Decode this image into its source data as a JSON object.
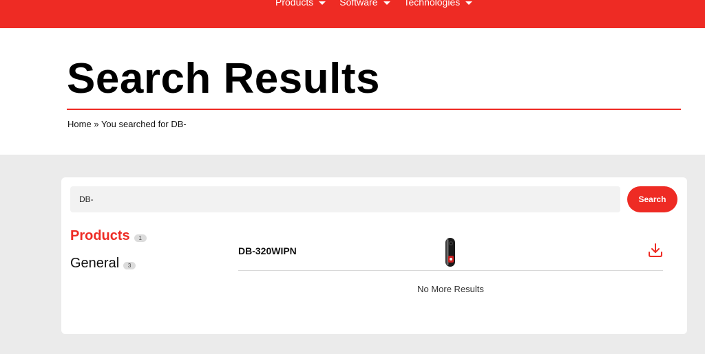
{
  "nav": {
    "items": [
      {
        "label": "Products",
        "icon": "caret-down-icon"
      },
      {
        "label": "Software",
        "icon": "caret-down-icon"
      },
      {
        "label": "Technologies",
        "icon": "caret-down-icon"
      }
    ]
  },
  "header": {
    "title": "Search Results",
    "breadcrumb": {
      "home": "Home",
      "separator": "»",
      "current": "You searched for DB-"
    }
  },
  "search": {
    "value": "DB-",
    "button_label": "Search"
  },
  "facets": [
    {
      "label": "Products",
      "count": "1",
      "active": true
    },
    {
      "label": "General",
      "count": "3",
      "active": false
    }
  ],
  "results": [
    {
      "name": "DB-320WIPN",
      "image": "video-doorbell-image",
      "icon": "download-icon"
    }
  ],
  "footer_text": "No More Results",
  "colors": {
    "accent": "#ee2b24",
    "band": "#ebebeb"
  }
}
